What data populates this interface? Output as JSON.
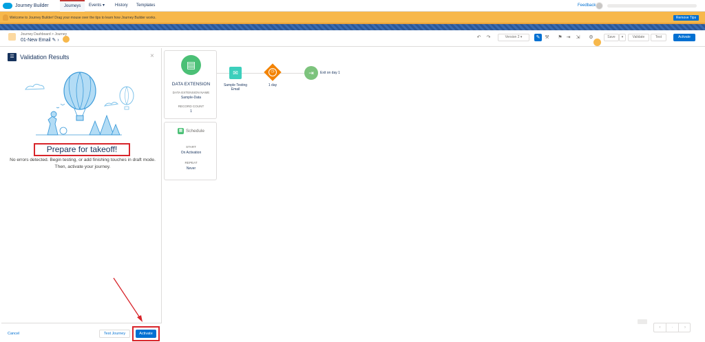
{
  "nav": {
    "app_name": "Journey Builder",
    "tabs": [
      {
        "label": "Journeys"
      },
      {
        "label": "Events ▾"
      },
      {
        "label": "History"
      },
      {
        "label": "Templates"
      }
    ],
    "feedback": "Feedback"
  },
  "tips": {
    "text_bold": "Welcome to Journey Builder!",
    "text": " Drag your mouse over the tips to learn how Journey Builder works.",
    "remove_label": "Remove Tips"
  },
  "header": {
    "breadcrumb": "Journey Dashboard > Journey",
    "journey_name": "01-New Email",
    "version": "Version 2 ▾",
    "save": "Save",
    "validate": "Validate",
    "test": "Test",
    "activate": "Activate"
  },
  "panel": {
    "title": "Validation Results",
    "heading": "Prepare for takeoff!",
    "message": "No errors detected. Begin testing, or add finishing touches in draft mode. Then, activate your journey.",
    "cancel": "Cancel",
    "test_journey": "Test Journey",
    "activate": "Activate"
  },
  "canvas": {
    "data_extension": {
      "title": "DATA EXTENSION",
      "name_label": "DATA EXTENSION NAME",
      "name_value": "Sample-Data",
      "count_label": "RECORD COUNT",
      "count_value": "1"
    },
    "schedule": {
      "title": "Schedule",
      "start_label": "START",
      "start_value": "On Activation",
      "repeat_label": "REPEAT",
      "repeat_value": "Never"
    },
    "email_node": {
      "label_line1": "Sample Testing",
      "label_line2": "Email"
    },
    "wait_node": {
      "label": "1 day"
    },
    "exit_node": {
      "label": "Exit on day 1"
    }
  },
  "colors": {
    "brand_blue": "#0070d2",
    "tips_orange": "#f7b84b",
    "highlight_red": "#d8242a",
    "de_green": "#4bc076",
    "email_teal": "#3ccfbc",
    "wait_orange": "#f38303"
  }
}
